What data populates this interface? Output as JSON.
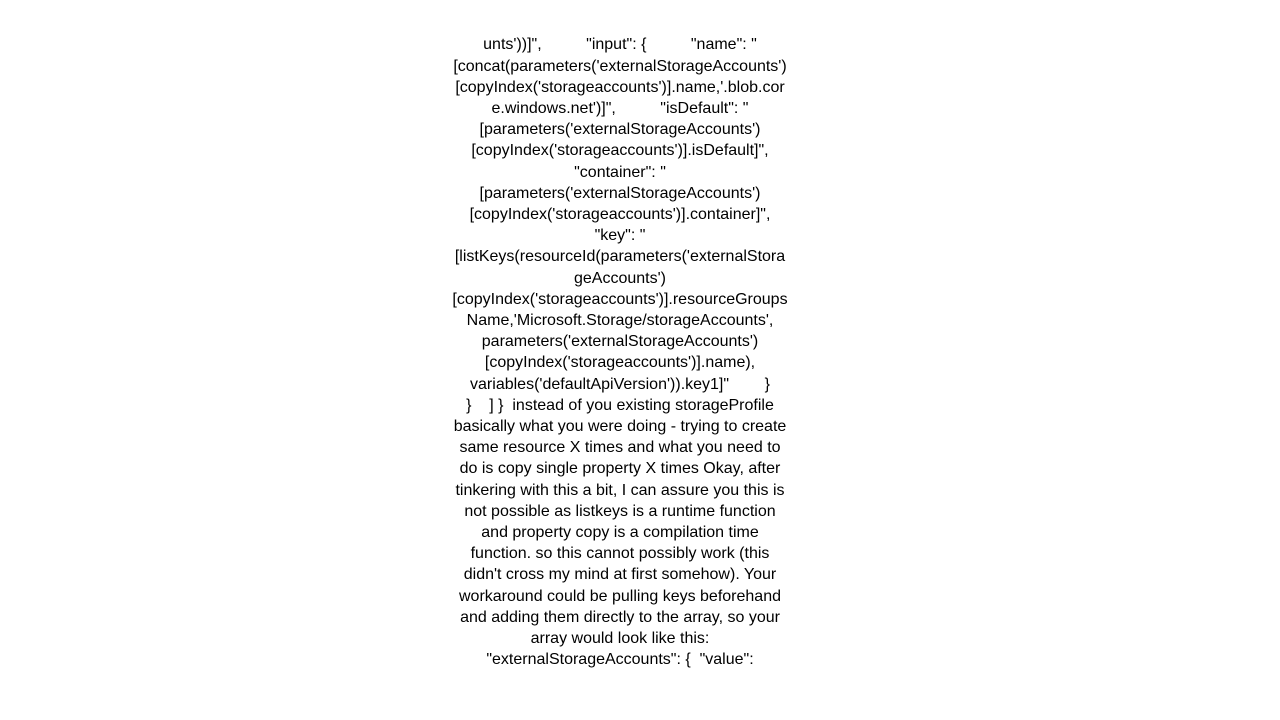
{
  "page": {
    "background_color": "#ffffff",
    "text_color": "#000000",
    "title": "Azure ARM template storage accounts copy discussion"
  },
  "document": {
    "body_text": "unts'))]\",          \"input\": {          \"name\": \"[concat(parameters('externalStorageAccounts')[copyIndex('storageaccounts')].name,'.blob.core.windows.net')]\",          \"isDefault\": \"[parameters('externalStorageAccounts')[copyIndex('storageaccounts')].isDefault]\",          \"container\": \"[parameters('externalStorageAccounts')[copyIndex('storageaccounts')].container]\",               \"key\": \"[listKeys(resourceId(parameters('externalStorageAccounts')[copyIndex('storageaccounts')].resourceGroupsName,'Microsoft.Storage/storageAccounts', parameters('externalStorageAccounts')[copyIndex('storageaccounts')].name), variables('defaultApiVersion')).key1]\"        }        }    ] }  instead of you existing storageProfile basically what you were doing - trying to create same resource X times and what you need to do is copy single property X times Okay, after tinkering with this a bit, I can assure you this is not possible as listkeys is a runtime function and property copy is a compilation time function. so this cannot possibly work (this didn't cross my mind at first somehow). Your workaround could be pulling keys beforehand and adding them directly to the array, so your array would look like this: \"externalStorageAccounts\": {  \"value\":"
  }
}
